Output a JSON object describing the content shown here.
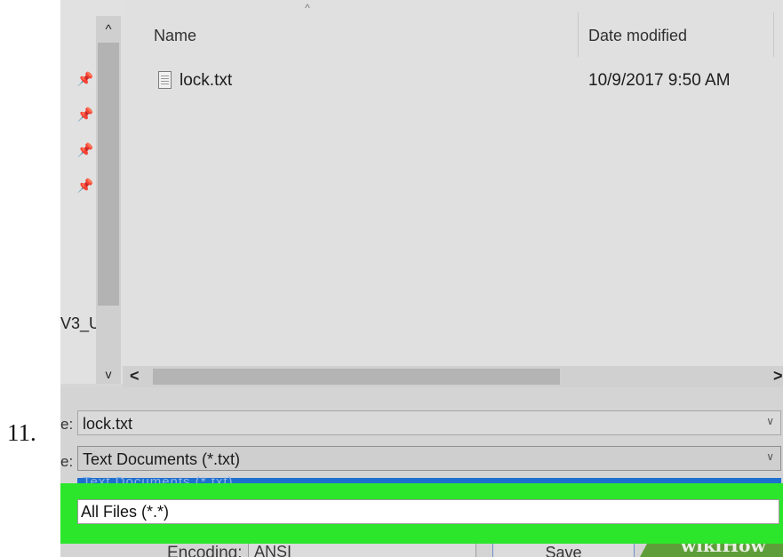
{
  "step": {
    "number": "11."
  },
  "nav": {
    "partial_label": "V3_U"
  },
  "scroll": {
    "up": "^",
    "down": "v",
    "left": "<",
    "right": ">"
  },
  "columns": {
    "name": "Name",
    "date": "Date modified",
    "sort_arrow": "^"
  },
  "files": [
    {
      "name": "lock.txt",
      "date": "10/9/2017 9:50 AM"
    }
  ],
  "form": {
    "filename_label": "e:",
    "filename_value": "lock.txt",
    "type_label": "e:",
    "type_value": "Text Documents (*.txt)",
    "dropdown_partial": "Text Documents (*.txt)",
    "highlighted_option": "All Files  (*.*)",
    "encoding_label": "Encoding:",
    "encoding_value": "ANSI",
    "save_label": "Save"
  },
  "watermark": "wikiHow",
  "colors": {
    "highlight": "#2ce62c",
    "selection": "#1f6fcf"
  }
}
